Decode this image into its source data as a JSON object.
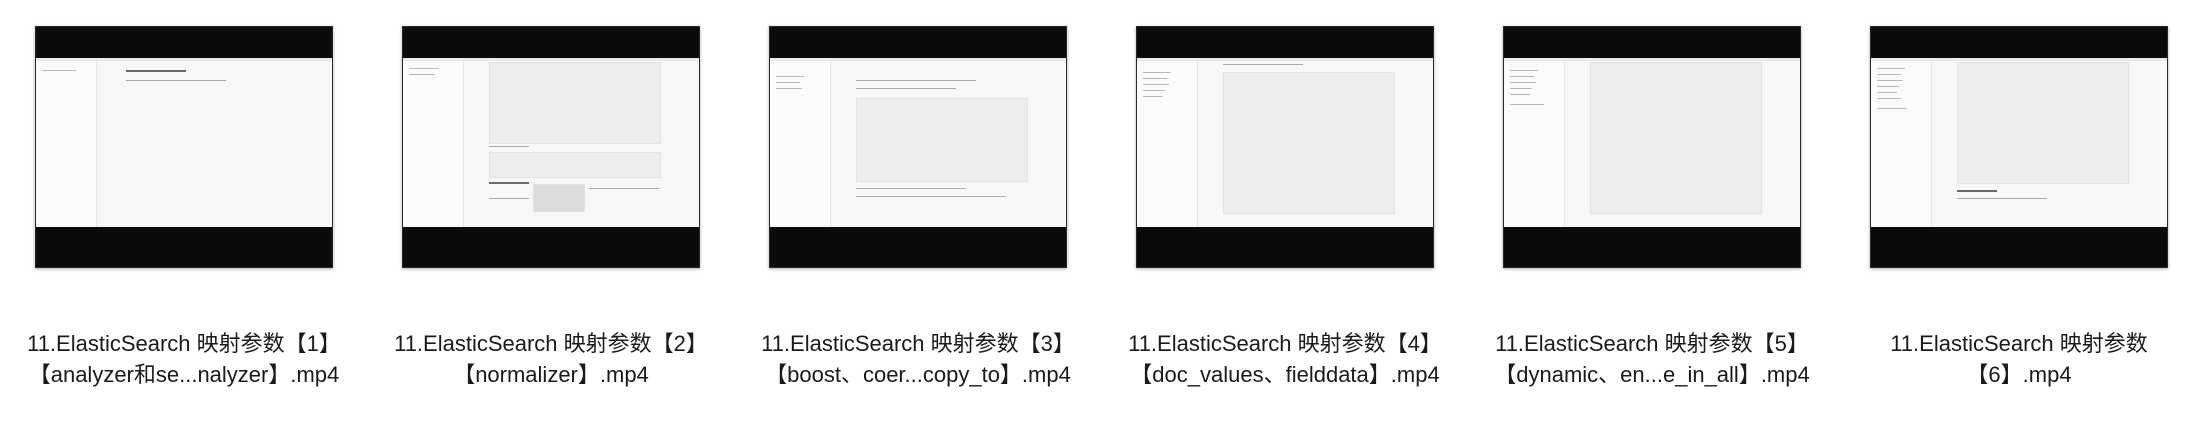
{
  "files": [
    {
      "line1": "11.ElasticSearch 映射参数【1】",
      "line2": "【analyzer和se...nalyzer】.mp4"
    },
    {
      "line1": "11.ElasticSearch 映射参数【2】",
      "line2": "【normalizer】.mp4"
    },
    {
      "line1": "11.ElasticSearch 映射参数【3】",
      "line2": "【boost、coer...copy_to】.mp4"
    },
    {
      "line1": "11.ElasticSearch 映射参数【4】",
      "line2": "【doc_values、fielddata】.mp4"
    },
    {
      "line1": "11.ElasticSearch 映射参数【5】",
      "line2": "【dynamic、en...e_in_all】.mp4"
    },
    {
      "line1": "11.ElasticSearch 映射参数",
      "line2": "【6】.mp4"
    }
  ]
}
